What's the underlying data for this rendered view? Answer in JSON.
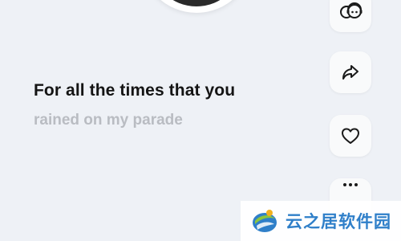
{
  "lyrics": {
    "current_line": "For all the times that you",
    "next_line": "rained on my parade"
  },
  "actions": [
    {
      "name": "listen-together",
      "icon": "listen-together-icon"
    },
    {
      "name": "share",
      "icon": "share-icon"
    },
    {
      "name": "like",
      "icon": "heart-icon"
    },
    {
      "name": "more",
      "icon": "more-icon"
    }
  ],
  "watermark": {
    "text": "云之居软件园"
  },
  "colors": {
    "background": "#eef1f6",
    "lyric_current": "#141414",
    "lyric_next": "#b9bcc2",
    "watermark_text": "#2f7fc9"
  }
}
